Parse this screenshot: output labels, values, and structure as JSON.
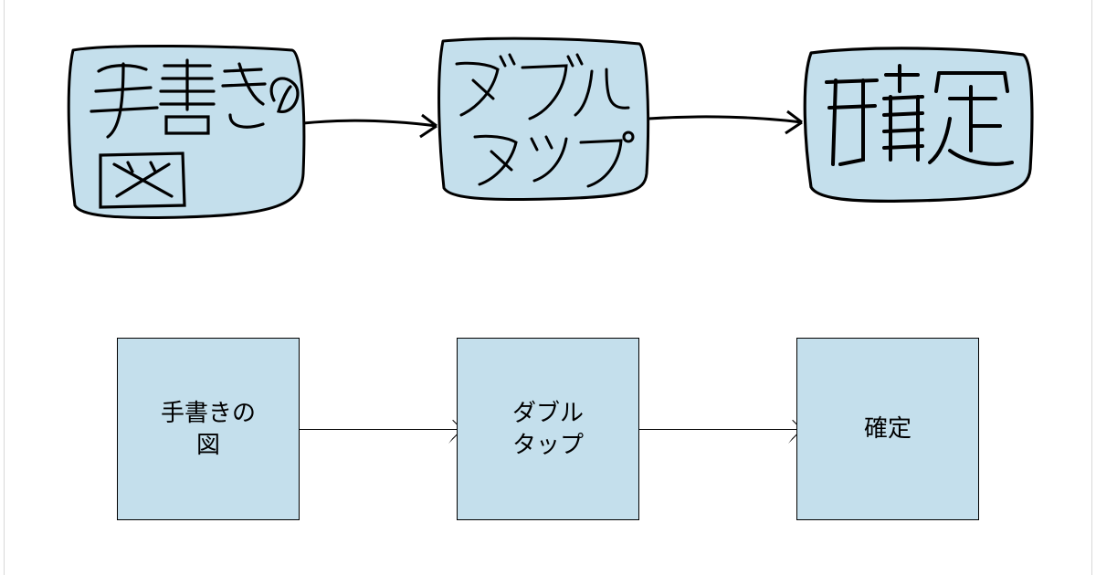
{
  "diagram": {
    "hand_drawn": {
      "nodes": [
        {
          "id": "hd-node-1",
          "label": "手書きの図"
        },
        {
          "id": "hd-node-2",
          "label": "ダブルタップ"
        },
        {
          "id": "hd-node-3",
          "label": "確定"
        }
      ],
      "edges": [
        {
          "from": "hd-node-1",
          "to": "hd-node-2"
        },
        {
          "from": "hd-node-2",
          "to": "hd-node-3"
        }
      ]
    },
    "clean": {
      "nodes": [
        {
          "id": "cl-node-1",
          "label_line1": "手書きの",
          "label_line2": "図"
        },
        {
          "id": "cl-node-2",
          "label_line1": "ダブル",
          "label_line2": "タップ"
        },
        {
          "id": "cl-node-3",
          "label_line1": "確定",
          "label_line2": ""
        }
      ],
      "edges": [
        {
          "from": "cl-node-1",
          "to": "cl-node-2"
        },
        {
          "from": "cl-node-2",
          "to": "cl-node-3"
        }
      ]
    },
    "colors": {
      "node_fill": "#c4dfec",
      "stroke": "#000000"
    }
  }
}
